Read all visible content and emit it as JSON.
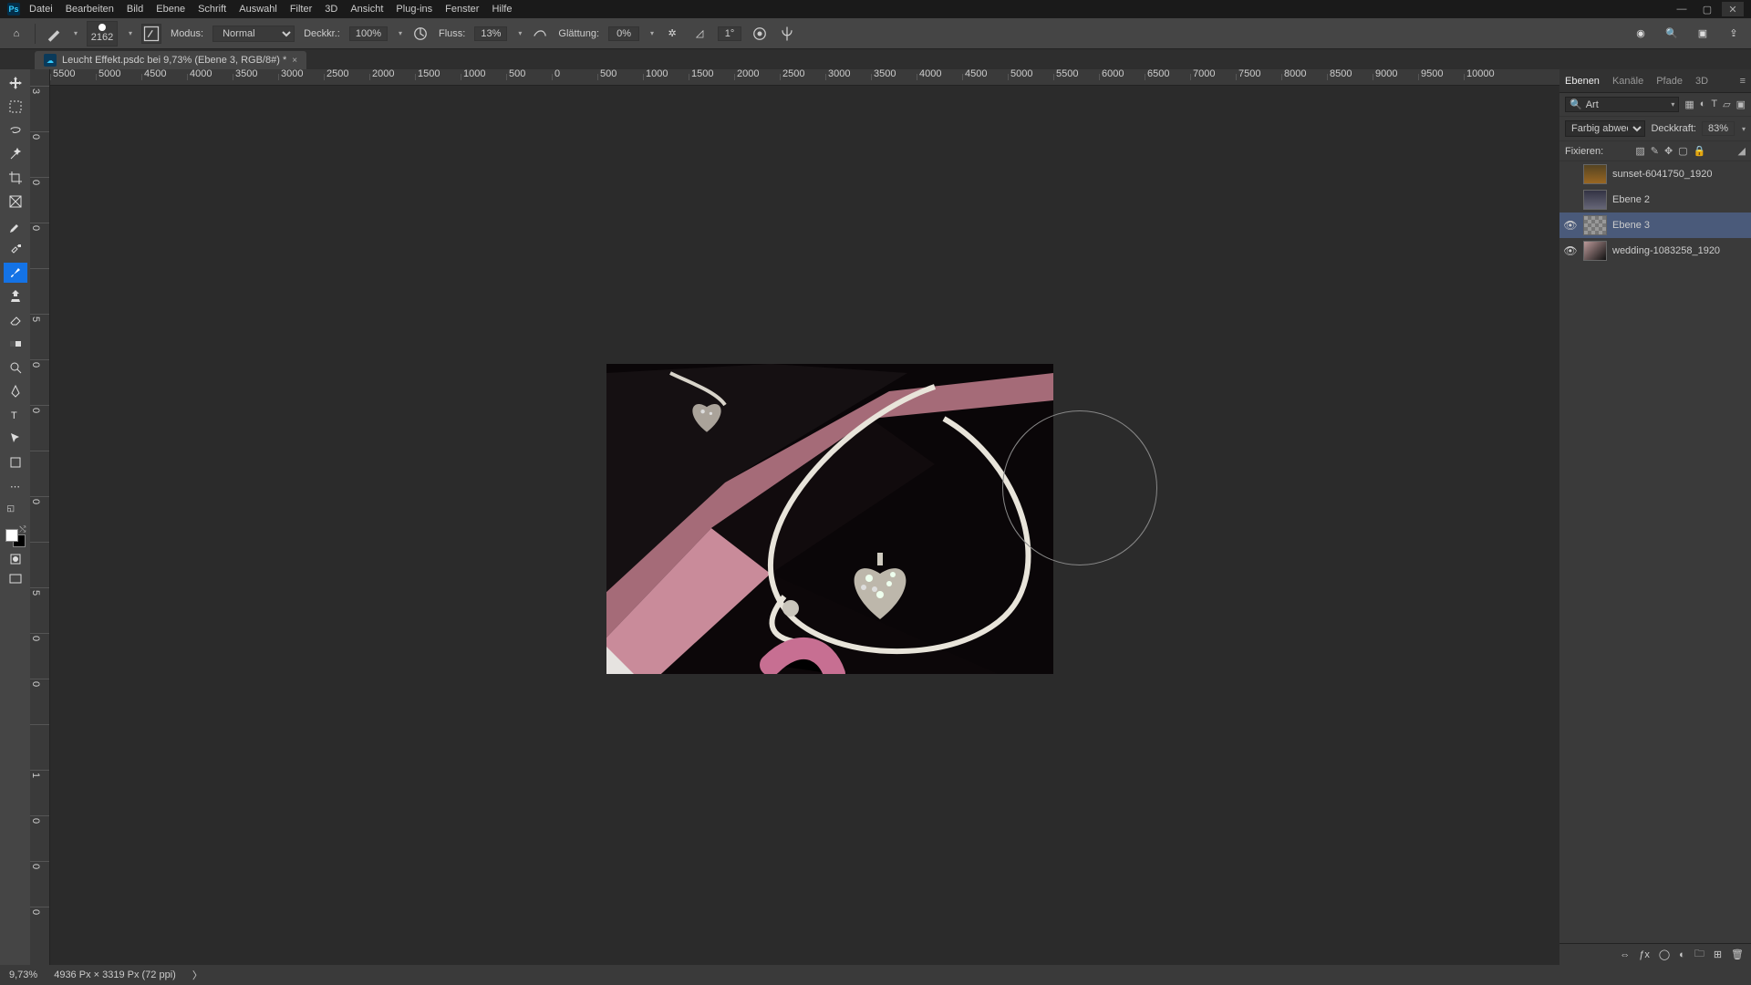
{
  "menu": [
    "Datei",
    "Bearbeiten",
    "Bild",
    "Ebene",
    "Schrift",
    "Auswahl",
    "Filter",
    "3D",
    "Ansicht",
    "Plug-ins",
    "Fenster",
    "Hilfe"
  ],
  "opt": {
    "brush_size": "2162",
    "modus_lbl": "Modus:",
    "modus_val": "Normal",
    "deckkr_lbl": "Deckkr.:",
    "deckkr_val": "100%",
    "fluss_lbl": "Fluss:",
    "fluss_val": "13%",
    "glatt_lbl": "Glättung:",
    "glatt_val": "0%",
    "angle_val": "1°"
  },
  "doc_tab": "Leucht Effekt.psdc bei 9,73% (Ebene 3, RGB/8#) *",
  "ruler_h": [
    "5500",
    "5000",
    "4500",
    "4000",
    "3500",
    "3000",
    "2500",
    "2000",
    "1500",
    "1000",
    "500",
    "0",
    "500",
    "1000",
    "1500",
    "2000",
    "2500",
    "3000",
    "3500",
    "4000",
    "4500",
    "5000",
    "5500",
    "6000",
    "6500",
    "7000",
    "7500",
    "8000",
    "8500",
    "9000",
    "9500",
    "10000"
  ],
  "ruler_v": [
    "3",
    "0",
    "0",
    "0",
    "",
    "5",
    "0",
    "0",
    "",
    "0",
    "",
    "5",
    "0",
    "0",
    "",
    "1",
    "0",
    "0",
    "0"
  ],
  "panel": {
    "tabs": [
      "Ebenen",
      "Kanäle",
      "Pfade",
      "3D"
    ],
    "search_mode": "Art",
    "blend_mode": "Farbig abwedeln",
    "opacity_lbl": "Deckkraft:",
    "opacity_val": "83%",
    "fix_lbl": "Fixieren:"
  },
  "layers": [
    {
      "name": "sunset-6041750_1920",
      "visible": false,
      "thumb": "img1",
      "active": false
    },
    {
      "name": "Ebene 2",
      "visible": false,
      "thumb": "img2",
      "active": false
    },
    {
      "name": "Ebene 3",
      "visible": true,
      "thumb": "chk",
      "active": true
    },
    {
      "name": "wedding-1083258_1920",
      "visible": true,
      "thumb": "img4",
      "active": false
    }
  ],
  "status": {
    "zoom": "9,73%",
    "dims": "4936 Px × 3319 Px (72 ppi)",
    "chev": "〉"
  }
}
